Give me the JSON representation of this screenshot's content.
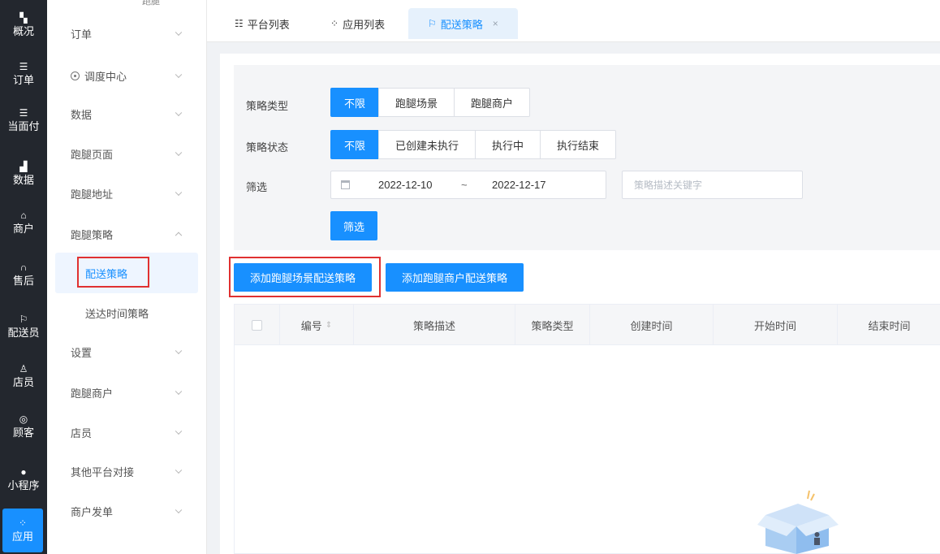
{
  "rail": {
    "items": [
      {
        "label": "概况",
        "icon": "dashboard-icon",
        "glyph": "▚"
      },
      {
        "label": "订单",
        "icon": "list-icon",
        "glyph": "☰"
      },
      {
        "label": "当面付",
        "icon": "list-icon",
        "glyph": "☰"
      },
      {
        "label": "数据",
        "icon": "bar-chart-icon",
        "glyph": "▟"
      },
      {
        "label": "商户",
        "icon": "shop-icon",
        "glyph": "⌂"
      },
      {
        "label": "售后",
        "icon": "headset-icon",
        "glyph": "∩"
      },
      {
        "label": "配送员",
        "icon": "scooter-icon",
        "glyph": "⚐"
      },
      {
        "label": "店员",
        "icon": "user-icon",
        "glyph": "♙"
      },
      {
        "label": "顾客",
        "icon": "customer-icon",
        "glyph": "◎"
      },
      {
        "label": "小程序",
        "icon": "wechat-icon",
        "glyph": "●"
      },
      {
        "label": "应用",
        "icon": "apps-icon",
        "glyph": "⁘"
      }
    ],
    "active_index": 10
  },
  "submenu": {
    "top_cut_label": "跑腿",
    "items": [
      {
        "label": "订单",
        "chevron": "down"
      },
      {
        "label": "调度中心",
        "chevron": "down",
        "icon": "location-icon"
      },
      {
        "label": "数据",
        "chevron": "down"
      },
      {
        "label": "跑腿页面",
        "chevron": "down"
      },
      {
        "label": "跑腿地址",
        "chevron": "down"
      },
      {
        "label": "跑腿策略",
        "chevron": "up"
      },
      {
        "label": "配送策略",
        "child": true,
        "active": true
      },
      {
        "label": "送达时间策略",
        "child": true
      },
      {
        "label": "设置",
        "chevron": "down"
      },
      {
        "label": "跑腿商户",
        "chevron": "down"
      },
      {
        "label": "店员",
        "chevron": "down"
      },
      {
        "label": "其他平台对接",
        "chevron": "down"
      },
      {
        "label": "商户发单",
        "chevron": "down"
      }
    ]
  },
  "tabs": [
    {
      "label": "平台列表",
      "icon": "platform-list-icon",
      "glyph": "☷"
    },
    {
      "label": "应用列表",
      "icon": "app-list-icon",
      "glyph": "⁘"
    },
    {
      "label": "配送策略",
      "icon": "scooter-icon",
      "glyph": "⚐",
      "active": true,
      "close": "×"
    }
  ],
  "filters": {
    "strategy_type": {
      "label": "策略类型",
      "options": [
        "不限",
        "跑腿场景",
        "跑腿商户"
      ],
      "selected": 0
    },
    "strategy_status": {
      "label": "策略状态",
      "options": [
        "不限",
        "已创建未执行",
        "执行中",
        "执行结束"
      ],
      "selected": 0
    },
    "screen": {
      "label": "筛选",
      "date_start": "2022-12-10",
      "date_separator": "~",
      "date_end": "2022-12-17",
      "keyword_placeholder": "策略描述关键字",
      "submit_label": "筛选"
    }
  },
  "actions": {
    "add_scene_label": "添加跑腿场景配送策略",
    "add_merchant_label": "添加跑腿商户配送策略"
  },
  "table": {
    "columns": [
      "编号",
      "策略描述",
      "策略类型",
      "创建时间",
      "开始时间",
      "结束时间"
    ],
    "sort_glyph": "⇕",
    "rows": []
  },
  "colors": {
    "primary": "#1890ff",
    "rail_bg": "#23272e",
    "highlight_red": "#e03131"
  }
}
